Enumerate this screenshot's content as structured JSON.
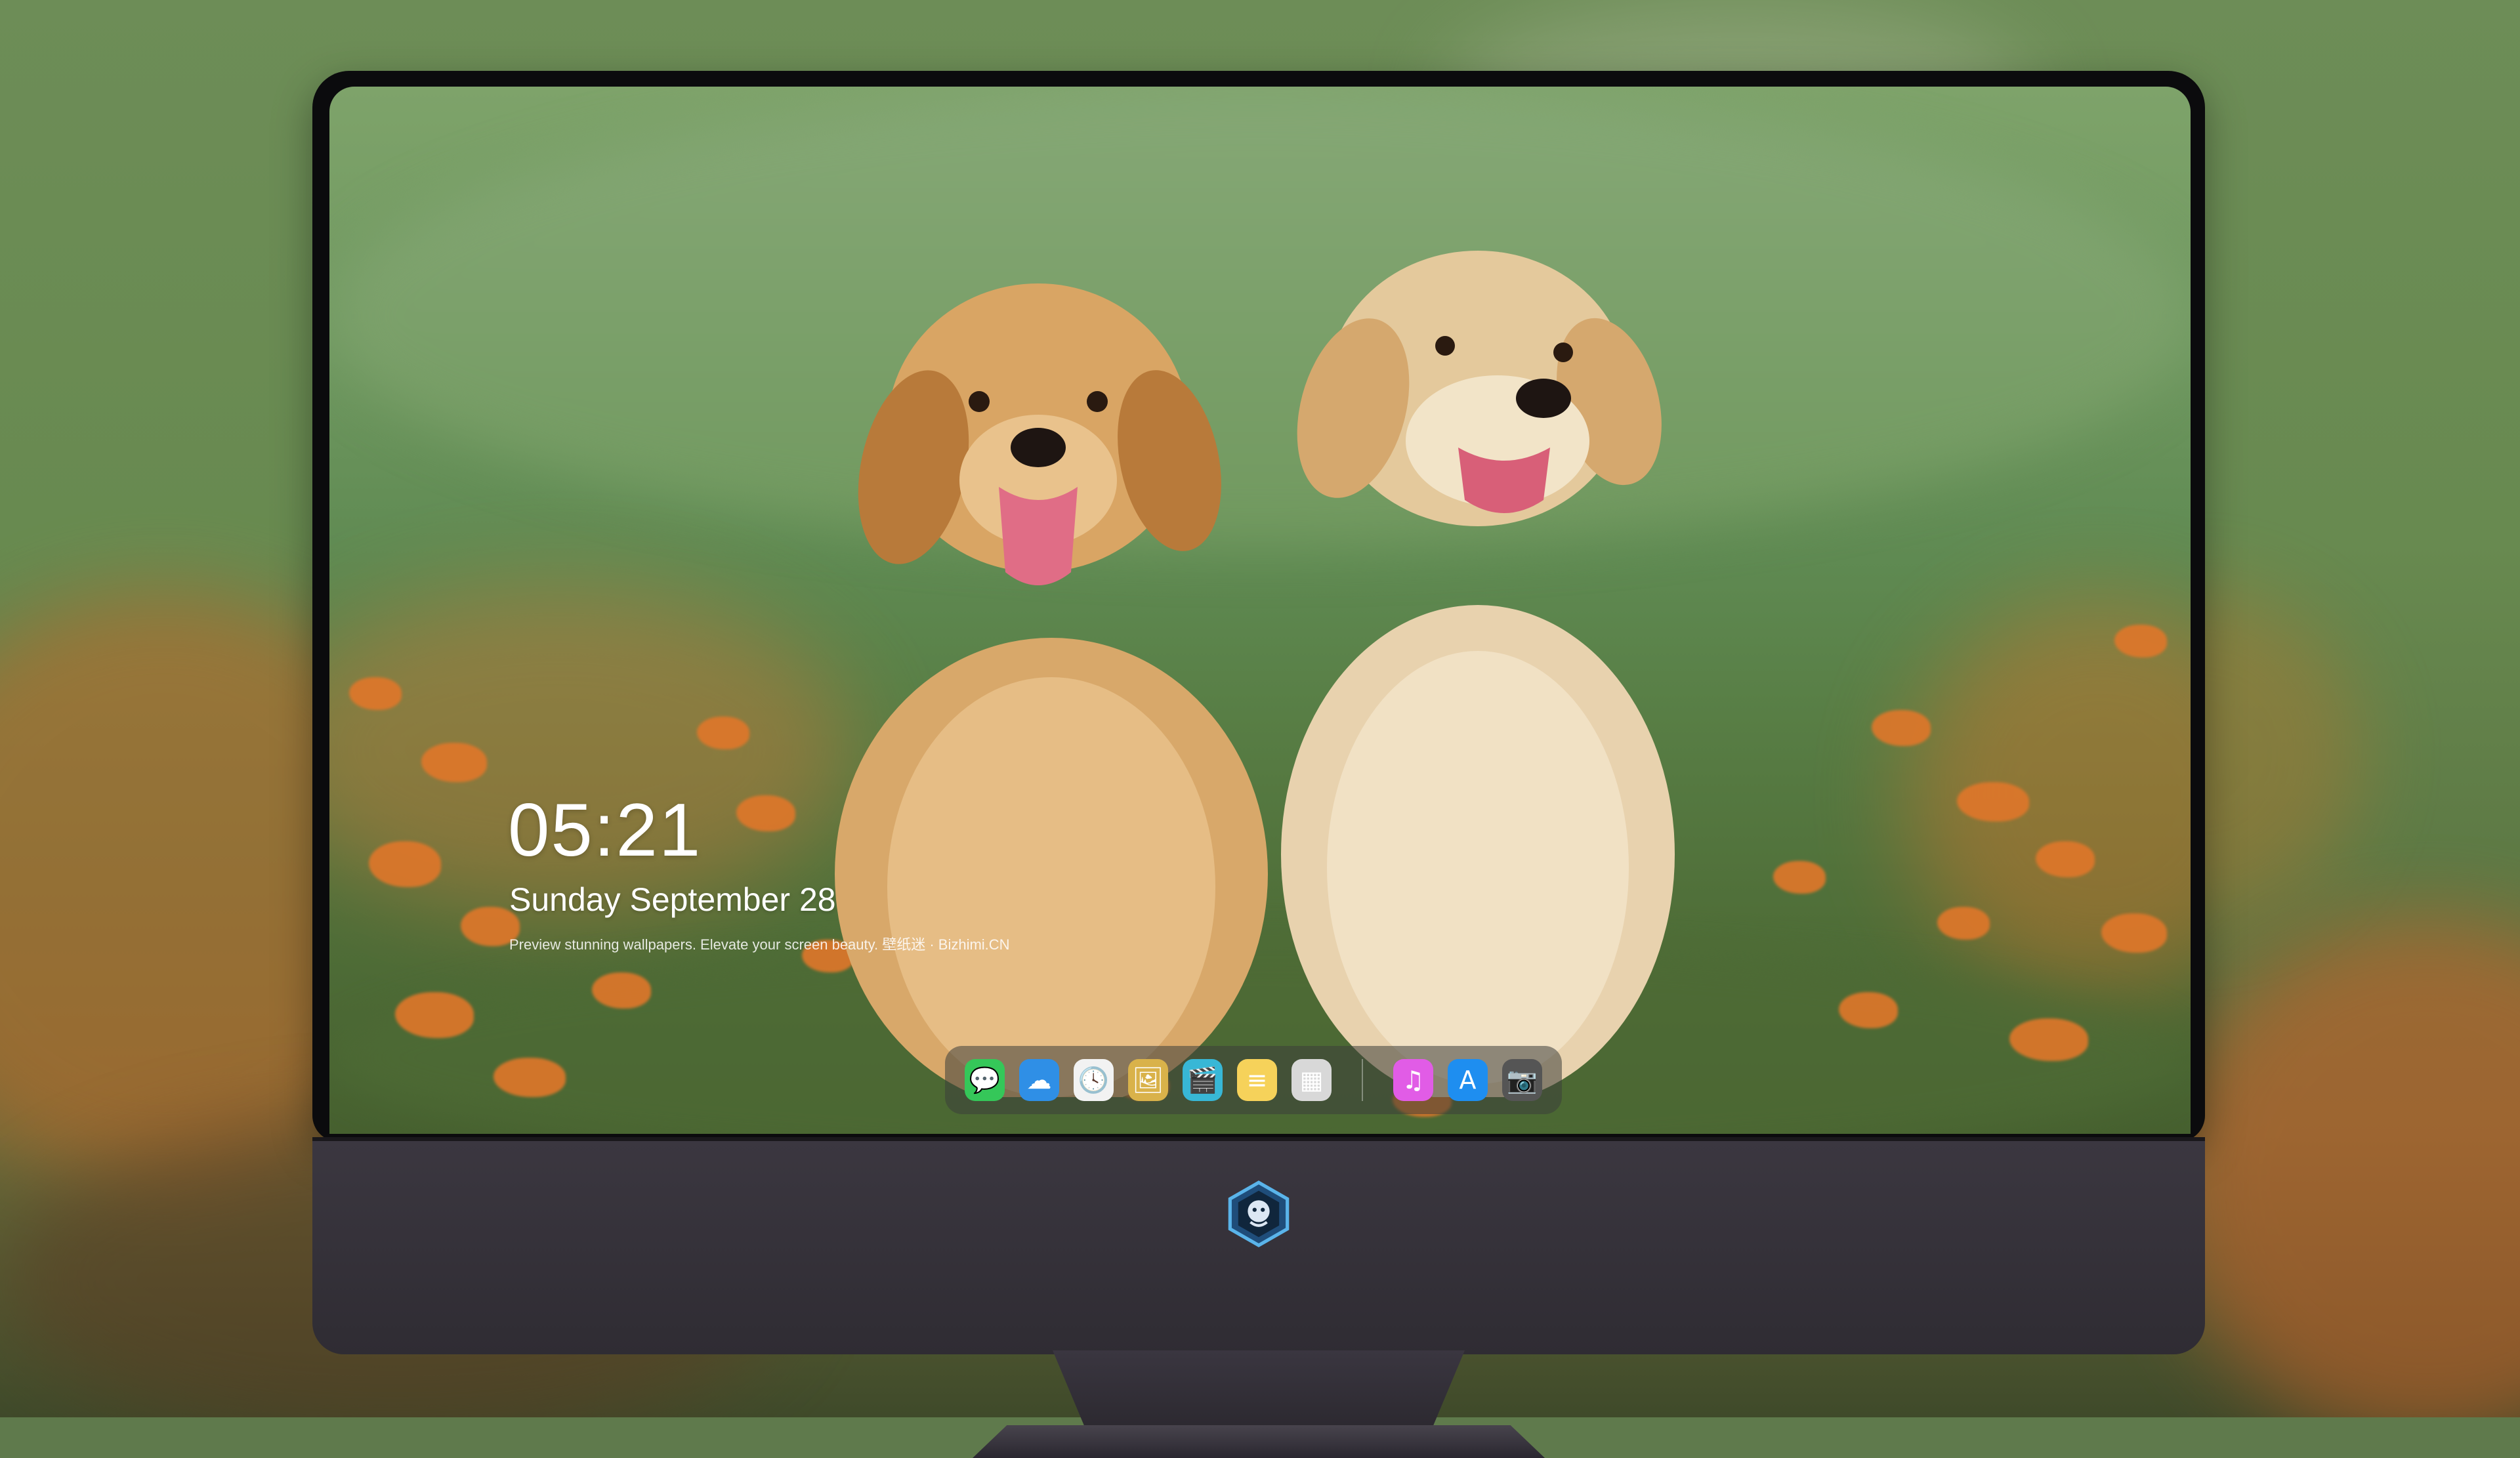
{
  "lock_screen": {
    "time": "05:21",
    "date": "Sunday September  28",
    "tagline": "Preview stunning wallpapers. Elevate your screen beauty. 壁纸迷 · Bizhimi.CN"
  },
  "dock": {
    "apps": [
      {
        "icon": "messages-icon",
        "glyph": "💬",
        "color": "#35c759"
      },
      {
        "icon": "weather-icon",
        "glyph": "☁",
        "color": "#2f8fe6"
      },
      {
        "icon": "clock-icon",
        "glyph": "🕓",
        "color": "#f2f2f2"
      },
      {
        "icon": "preview-icon",
        "glyph": "🖼",
        "color": "#d9b24a"
      },
      {
        "icon": "clips-icon",
        "glyph": "🎬",
        "color": "#38b7d6"
      },
      {
        "icon": "notes-icon",
        "glyph": "≡",
        "color": "#f6d25a"
      },
      {
        "icon": "photo-booth-icon",
        "glyph": "▦",
        "color": "#d8d8d8"
      }
    ],
    "apps_right": [
      {
        "icon": "music-icon",
        "glyph": "♫",
        "color": "#e15ce6"
      },
      {
        "icon": "app-store-icon",
        "glyph": "A",
        "color": "#1e8ef0"
      },
      {
        "icon": "camera-icon",
        "glyph": "📷",
        "color": "#555555"
      }
    ]
  },
  "colors": {
    "monitor_chin": "#3b3740",
    "bezel": "#0b0b0d",
    "grass": "#5f8a52",
    "flower": "#e0772a"
  }
}
